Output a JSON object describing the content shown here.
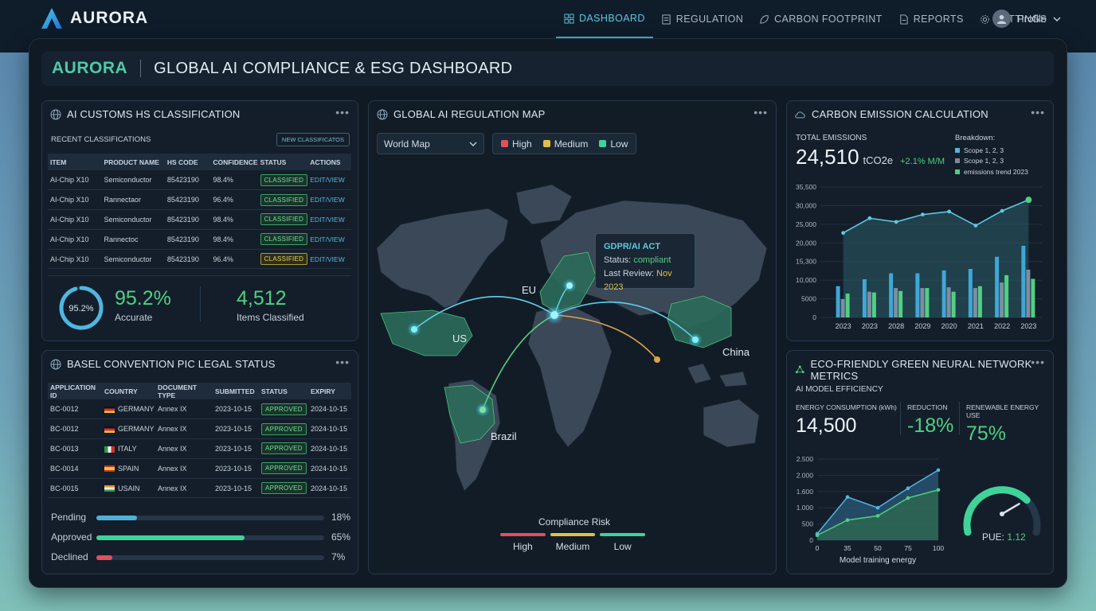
{
  "app": {
    "logo": "AURORA"
  },
  "nav": [
    {
      "label": "DASHBOARD",
      "icon": "grid-icon",
      "active": true
    },
    {
      "label": "REGULATION",
      "icon": "document-icon",
      "active": false
    },
    {
      "label": "CARBON FOOTPRINT",
      "icon": "leaf-icon",
      "active": false
    },
    {
      "label": "REPORTS",
      "icon": "report-icon",
      "active": false
    },
    {
      "label": "SETTINGS",
      "icon": "gear-icon",
      "active": false
    }
  ],
  "profile": {
    "label": "Profile"
  },
  "header": {
    "brand": "AURORA",
    "title": "GLOBAL AI COMPLIANCE & ESG DASHBOARD"
  },
  "customs": {
    "title": "AI CUSTOMS HS CLASSIFICATION",
    "subtitle": "RECENT CLASSIFICATIONS",
    "new_button": "NEW CLASSIFICATOS",
    "columns": [
      "ITEM",
      "PRODUCT NAME",
      "HS CODE",
      "CONFIDENCE",
      "STATUS",
      "ACTIONS"
    ],
    "rows": [
      {
        "item": "AI-Chip X10",
        "product": "Semiconductor",
        "hs": "85423190",
        "confidence": "98.4%",
        "status": "CLASSIFIED",
        "status_color": "green",
        "action": "EDIT/VIEW"
      },
      {
        "item": "AI-Chip X10",
        "product": "Rannectaor",
        "hs": "85423190",
        "confidence": "96.4%",
        "status": "CLASSIFIED",
        "status_color": "green",
        "action": "EDIT/VIEW"
      },
      {
        "item": "AI-Chip X10",
        "product": "Semiconductor",
        "hs": "85423190",
        "confidence": "98.4%",
        "status": "CLASSIFIED",
        "status_color": "green",
        "action": "EDIT/VIEW"
      },
      {
        "item": "AI-Chip X10",
        "product": "Rannectoc",
        "hs": "85423190",
        "confidence": "98.4%",
        "status": "CLASSIFIED",
        "status_color": "green",
        "action": "EDIT/VIEW"
      },
      {
        "item": "AI-Chip X10",
        "product": "Semiconductor",
        "hs": "85423190",
        "confidence": "96.4%",
        "status": "CLASSIFIED",
        "status_color": "yellow",
        "action": "EDIT/VIEW"
      }
    ],
    "ring_label": "95.2%",
    "ring_fraction": 0.952,
    "accuracy_value": "95.2%",
    "accuracy_label": "Accurate",
    "items_value": "4,512",
    "items_label": "Items Classified"
  },
  "basel": {
    "title": "BASEL CONVENTION PIC LEGAL STATUS",
    "columns": [
      "APPLICATION ID",
      "COUNTRY",
      "DOCUMENT TYPE",
      "SUBMITTED",
      "STATUS",
      "EXPIRY"
    ],
    "rows": [
      {
        "id": "BC-0012",
        "flag": "germany",
        "country": "GERMANY",
        "doc": "Annex IX",
        "submitted": "2023-10-15",
        "status": "APPROVED",
        "expiry": "2024-10-15"
      },
      {
        "id": "BC-0012",
        "flag": "germany",
        "country": "GERMANY",
        "doc": "Annex IX",
        "submitted": "2023-10-15",
        "status": "APPROVED",
        "expiry": "2024-10-15"
      },
      {
        "id": "BC-0013",
        "flag": "italy",
        "country": "ITALY",
        "doc": "Annex IX",
        "submitted": "2023-10-15",
        "status": "APPROVED",
        "expiry": "2024-10-15"
      },
      {
        "id": "BC-0014",
        "flag": "spain",
        "country": "SPAIN",
        "doc": "Annex IX",
        "submitted": "2023-10-15",
        "status": "APPROVED",
        "expiry": "2024-10-15"
      },
      {
        "id": "BC-0015",
        "flag": "india",
        "country": "USAIN",
        "doc": "Annex IX",
        "submitted": "2023-10-15",
        "status": "APPROVED",
        "expiry": "2024-10-15"
      }
    ],
    "progress": [
      {
        "label": "Pending",
        "value": "18%",
        "fraction": 0.18,
        "color": "#4fb0d8"
      },
      {
        "label": "Approved",
        "value": "65%",
        "fraction": 0.65,
        "color": "#3fd39a"
      },
      {
        "label": "Declined",
        "value": "7%",
        "fraction": 0.07,
        "color": "#e0505f"
      }
    ]
  },
  "map": {
    "title": "GLOBAL AI REGULATION MAP",
    "dropdown_value": "World Map",
    "risk_legend": [
      {
        "label": "High",
        "color": "#e0505f"
      },
      {
        "label": "Medium",
        "color": "#e0c04a"
      },
      {
        "label": "Low",
        "color": "#3fd39a"
      }
    ],
    "regions": [
      {
        "label": "EU"
      },
      {
        "label": "US"
      },
      {
        "label": "China"
      },
      {
        "label": "Brazil"
      }
    ],
    "tooltip": {
      "title": "GDPR/AI ACT",
      "status_label": "Status:",
      "status_value": "compliant",
      "review_label": "Last Review:",
      "review_value": "Nov 2023"
    },
    "bottom_legend_title": "Compliance Risk",
    "bottom_legend": [
      {
        "label": "High",
        "color": "#e0505f"
      },
      {
        "label": "Medium",
        "color": "#e0c04a"
      },
      {
        "label": "Low",
        "color": "#3fd39a"
      }
    ]
  },
  "carbon": {
    "title": "CARBON EMISSION CALCULATION",
    "total_label": "TOTAL EMISSIONS",
    "total_value": "24,510",
    "total_unit": "tCO2e",
    "change": "+2.1% M/M",
    "breakdown_title": "Breakdown:",
    "breakdown": [
      {
        "label": "Scope 1, 2, 3",
        "color": "#4fb6e0"
      },
      {
        "label": "Scope 1, 2, 3",
        "color": "#7a8a9b"
      },
      {
        "label": "emissions trend 2023",
        "color": "#4fd083"
      }
    ]
  },
  "eco": {
    "title": "ECO-FRIENDLY GREEN NEURAL NETWORK METRICS",
    "subtitle": "AI MODEL EFFICIENCY",
    "metrics": [
      {
        "label": "ENERGY CONSUMPTION (kWh)",
        "value": "14,500"
      },
      {
        "label": "REDUCTION",
        "value": "-18%"
      },
      {
        "label": "RENEWABLE ENERGY USE",
        "value": "75%"
      }
    ],
    "gauge_label": "PUE:",
    "gauge_value": "1.12",
    "gauge_fraction": 0.72
  },
  "chart_data": [
    {
      "type": "bar",
      "title": "",
      "categories": [
        "2023",
        "2023",
        "2028",
        "2029",
        "2020",
        "2021",
        "2022",
        "2023"
      ],
      "yticks": [
        "0",
        "5000",
        "10,000",
        "15,300",
        "20,000",
        "25,000",
        "30,000",
        "35,500"
      ],
      "ylim": [
        0,
        35500
      ],
      "line": [
        23000,
        27000,
        26000,
        28000,
        28800,
        25000,
        29000,
        32000
      ],
      "series": [
        {
          "values": [
            8500,
            10400,
            12000,
            12000,
            12800,
            13200,
            16500,
            19500
          ],
          "color": "#3fa7d6"
        },
        {
          "values": [
            5000,
            7000,
            8000,
            8000,
            8200,
            8000,
            9500,
            13000
          ],
          "color": "#7d8ea0"
        },
        {
          "values": [
            6500,
            6800,
            7200,
            8000,
            7000,
            8500,
            11500,
            10500
          ],
          "color": "#4fd083"
        }
      ],
      "grid": true
    },
    {
      "type": "area",
      "title": "",
      "xlabel": "Model training energy",
      "x": [
        0,
        25,
        50,
        75,
        100
      ],
      "xticks": [
        "0",
        "35",
        "50",
        "75",
        "100"
      ],
      "yticks": [
        "0",
        "500",
        "1.000",
        "1.600",
        "2.000",
        "2.500"
      ],
      "ylim": [
        0,
        2500
      ],
      "series": [
        {
          "x": [
            0,
            25,
            50,
            75,
            100
          ],
          "values": [
            200,
            1330,
            1000,
            1600,
            2160
          ],
          "color": "#4fb6e0"
        },
        {
          "x": [
            0,
            25,
            50,
            75,
            100
          ],
          "values": [
            150,
            620,
            750,
            1300,
            1550
          ],
          "color": "#4fd083"
        }
      ],
      "grid": true
    }
  ]
}
